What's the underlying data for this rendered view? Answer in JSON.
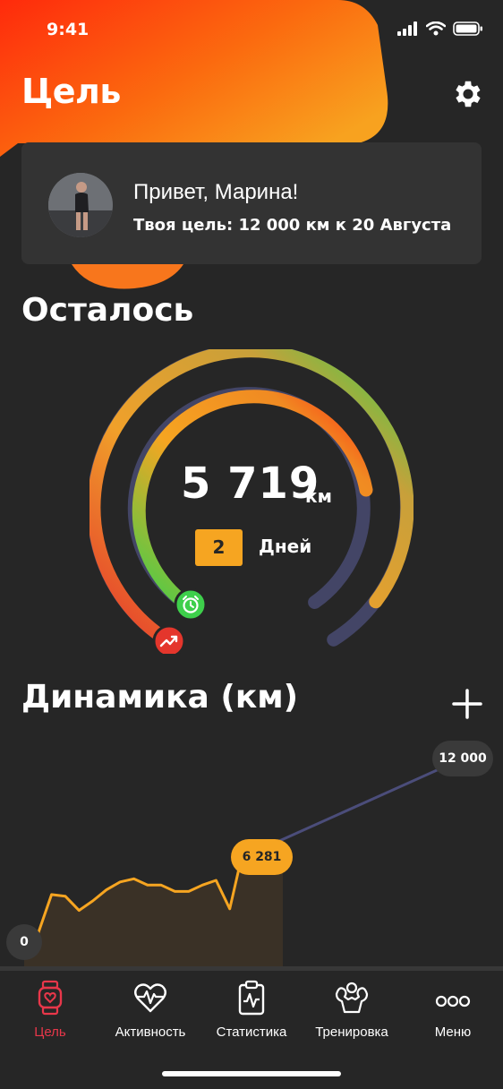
{
  "status": {
    "time": "9:41"
  },
  "header": {
    "title": "Цель"
  },
  "profile": {
    "greeting": "Привет, Марина!",
    "goal": "Твоя цель: 12 000 км к 20 Августа"
  },
  "remaining": {
    "title": "Осталось",
    "distance": "5 719",
    "unit": "км",
    "days_value": "2",
    "days_label": "Дней",
    "distance_progress": 0.52,
    "time_progress": 0.73
  },
  "dynamics": {
    "title": "Динамика (км)",
    "start_label": "0",
    "current_label": "6 281",
    "goal_label": "12 000"
  },
  "chart_data": {
    "type": "line",
    "title": "Динамика (км)",
    "series": [
      {
        "values": [
          0,
          900,
          3400,
          3300,
          2400,
          3000,
          3700,
          4200,
          4400,
          4000,
          4000,
          3600,
          3600,
          4000,
          4300,
          2500,
          6281
        ]
      },
      {
        "values": [
          6281,
          12000
        ]
      }
    ],
    "ylim": [
      0,
      12000
    ],
    "point_labels": [
      "0",
      "6 281",
      "12 000"
    ],
    "colors": {
      "progress": "#f6a521",
      "projection": "#4b4d7a"
    }
  },
  "colors": {
    "accent_orange": "#f6a521",
    "accent_red": "#e8374a",
    "green": "#3ecf4b",
    "track": "#434566"
  },
  "tabs": [
    {
      "label": "Цель",
      "icon": "smartwatch-icon"
    },
    {
      "label": "Активность",
      "icon": "heart-pulse-icon"
    },
    {
      "label": "Статистика",
      "icon": "clipboard-chart-icon"
    },
    {
      "label": "Тренировка",
      "icon": "muscle-icon"
    },
    {
      "label": "Меню",
      "icon": "more-icon"
    }
  ]
}
